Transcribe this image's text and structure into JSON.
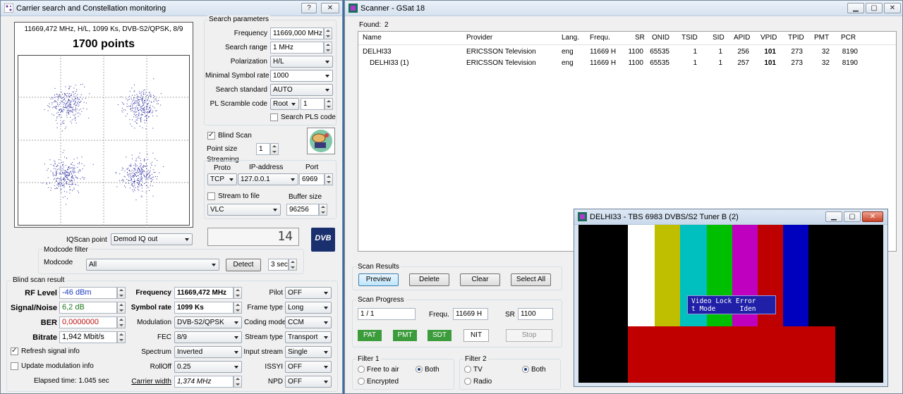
{
  "left_window": {
    "title": "Carrier search and Constellation monitoring",
    "help_label": "?",
    "close_label": "✕",
    "constellation": {
      "info": "11669,472 MHz, H/L, 1099 Ks, DVB-S2/QPSK, 8/9",
      "points_label": "1700 points"
    },
    "search_params": {
      "group_label": "Search parameters",
      "frequency_label": "Frequency",
      "frequency_value": "11669,000 MHz",
      "search_range_label": "Search range",
      "search_range_value": "1 MHz",
      "polarization_label": "Polarization",
      "polarization_value": "H/L",
      "min_sr_label": "Minimal Symbol rate",
      "min_sr_value": "1000",
      "standard_label": "Search standard",
      "standard_value": "AUTO",
      "pls_label": "PL Scramble code",
      "pls_mode": "Root",
      "pls_value": "1",
      "search_pls_label": "Search PLS code"
    },
    "blind_scan_label": "Blind Scan",
    "point_size_label": "Point size",
    "point_size_value": "1",
    "streaming": {
      "group_label": "Streaming",
      "proto_label": "Proto",
      "ip_label": "IP-address",
      "port_label": "Port",
      "proto_value": "TCP",
      "ip_value": "127.0.0.1",
      "port_value": "6969",
      "stream_file_label": "Stream to file",
      "buffer_label": "Buffer size",
      "player_value": "VLC",
      "buffer_value": "96256"
    },
    "lcd_value": "14",
    "dvb_logo": "DVB",
    "iqscan_label": "IQScan point",
    "iqscan_value": "Demod IQ out",
    "modcode": {
      "group_label": "Modcode filter",
      "label": "Modcode",
      "value": "All",
      "detect_label": "Detect",
      "time_value": "3 sec"
    },
    "result": {
      "group_label": "Blind scan result",
      "rf_label": "RF Level",
      "rf_value": "-46 dBm",
      "sn_label": "Signal/Noise",
      "sn_value": "6,2 dB",
      "ber_label": "BER",
      "ber_value": "0,0000000",
      "bitrate_label": "Bitrate",
      "bitrate_value": "1,942 Mbit/s",
      "refresh_label": "Refresh signal info",
      "update_label": "Update modulation info",
      "elapsed_label": "Elapsed time: 1.045 sec",
      "freq_label": "Frequency",
      "freq_value": "11669,472 MHz",
      "sr_label": "Symbol rate",
      "sr_value": "1099 Ks",
      "mod_label": "Modulation",
      "mod_value": "DVB-S2/QPSK",
      "fec_label": "FEC",
      "fec_value": "8/9",
      "spectrum_label": "Spectrum",
      "spectrum_value": "Inverted",
      "rolloff_label": "RollOff",
      "rolloff_value": "0.25",
      "cw_label": "Carrier width",
      "cw_value": "1,374 MHz",
      "pilot_label": "Pilot",
      "pilot_value": "OFF",
      "frame_label": "Frame type",
      "frame_value": "Long",
      "coding_label": "Coding mode",
      "coding_value": "CCM",
      "stype_label": "Stream type",
      "stype_value": "Transport",
      "istream_label": "Input stream",
      "istream_value": "Single",
      "issyi_label": "ISSYI",
      "issyi_value": "OFF",
      "npd_label": "NPD",
      "npd_value": "OFF"
    }
  },
  "scanner": {
    "title": "Scanner - GSat 18",
    "found_label": "Found:",
    "found_value": "2",
    "columns": [
      "Name",
      "Provider",
      "Lang.",
      "Frequ.",
      "SR",
      "ONID",
      "TSID",
      "SID",
      "APID",
      "VPID",
      "TPID",
      "PMT",
      "PCR"
    ],
    "rows": [
      [
        "DELHI33",
        "ERICSSON Television",
        "eng",
        "11669 H",
        "1100",
        "65535",
        "1",
        "1",
        "256",
        "101",
        "273",
        "32",
        "8190"
      ],
      [
        "DELHI33 (1)",
        "ERICSSON Television",
        "eng",
        "11669 H",
        "1100",
        "65535",
        "1",
        "1",
        "257",
        "101",
        "273",
        "32",
        "8190"
      ]
    ],
    "scan_results": {
      "group_label": "Scan Results",
      "preview_label": "Preview",
      "delete_label": "Delete",
      "clear_label": "Clear",
      "select_all_label": "Select All"
    },
    "progress": {
      "group_label": "Scan Progress",
      "count_value": "1 / 1",
      "frequ_label": "Frequ.",
      "frequ_value": "11669 H",
      "sr_label": "SR",
      "sr_value": "1100",
      "pat_label": "PAT",
      "pmt_label": "PMT",
      "sdt_label": "SDT",
      "nit_label": "NIT",
      "stop_label": "Stop"
    },
    "filter1": {
      "group_label": "Filter 1",
      "fta_label": "Free to air",
      "both_label": "Both",
      "enc_label": "Encrypted"
    },
    "filter2": {
      "group_label": "Filter 2",
      "tv_label": "TV",
      "both_label": "Both",
      "radio_label": "Radio"
    }
  },
  "video": {
    "title": "DELHI33 - TBS 6983 DVBS/S2 Tuner B (2)",
    "error_line1": "Video Lock Error",
    "error_line2": "t Mode      Iden",
    "bar_colors": [
      "#000000",
      "#ffffff",
      "#bfbf00",
      "#00bfbf",
      "#00bf00",
      "#bf00bf",
      "#bf0000",
      "#0000bf",
      "#000000"
    ],
    "bottom_color": "#c00000"
  },
  "colors": {
    "rf_value": "#1e40c0",
    "sn_value": "#1e7a1e",
    "ber_value": "#c01010",
    "points": "#2a2aa0"
  }
}
